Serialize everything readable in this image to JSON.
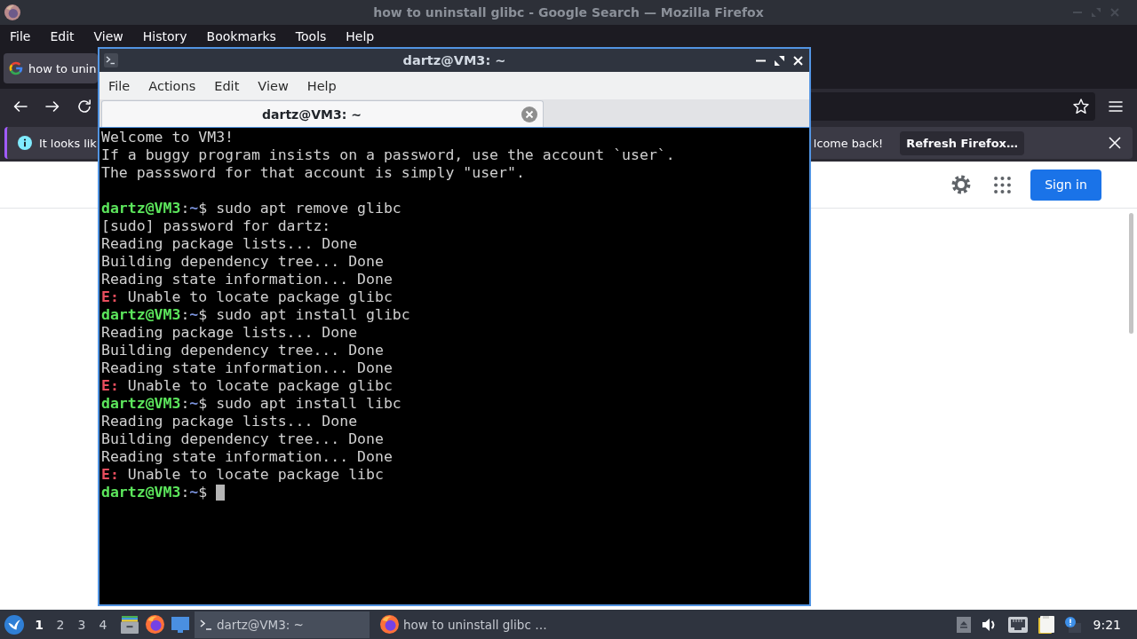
{
  "browser": {
    "title": "how to uninstall glibc - Google Search — Mozilla Firefox",
    "menu": [
      "File",
      "Edit",
      "View",
      "History",
      "Bookmarks",
      "Tools",
      "Help"
    ],
    "tabs": [
      {
        "label": "how to unin",
        "selected": true
      }
    ],
    "notification": {
      "text_start": "It looks lik",
      "text_end": "lcome back!",
      "button": "Refresh Firefox…"
    },
    "page": {
      "sign_in": "Sign in"
    }
  },
  "terminal": {
    "title": "dartz@VM3: ~",
    "menu": [
      "File",
      "Actions",
      "Edit",
      "View",
      "Help"
    ],
    "tabs": [
      {
        "label": "dartz@VM3: ~",
        "selected": true
      }
    ],
    "blocks": [
      {
        "lines": [
          {
            "segments": [
              {
                "kind": "plain",
                "text": "Welcome to VM3!"
              }
            ]
          },
          {
            "segments": [
              {
                "kind": "plain",
                "text": "If a buggy program insists on a password, use the account `user`."
              }
            ]
          },
          {
            "segments": [
              {
                "kind": "plain",
                "text": "The passsword for that account is simply \"user\"."
              }
            ]
          }
        ]
      },
      {
        "lines": [
          {
            "segments": [
              {
                "kind": "user",
                "text": "dartz@VM3"
              },
              {
                "kind": "plain",
                "text": ":"
              },
              {
                "kind": "path",
                "text": "~"
              },
              {
                "kind": "plain",
                "text": "$ sudo apt remove glibc"
              }
            ]
          },
          {
            "segments": [
              {
                "kind": "plain",
                "text": "[sudo] password for dartz:"
              }
            ]
          },
          {
            "segments": [
              {
                "kind": "plain",
                "text": "Reading package lists... Done"
              }
            ]
          },
          {
            "segments": [
              {
                "kind": "plain",
                "text": "Building dependency tree... Done"
              }
            ]
          },
          {
            "segments": [
              {
                "kind": "plain",
                "text": "Reading state information... Done"
              }
            ]
          },
          {
            "segments": [
              {
                "kind": "error",
                "text": "E:"
              },
              {
                "kind": "plain",
                "text": " Unable to locate package glibc"
              }
            ]
          },
          {
            "segments": [
              {
                "kind": "user",
                "text": "dartz@VM3"
              },
              {
                "kind": "plain",
                "text": ":"
              },
              {
                "kind": "path",
                "text": "~"
              },
              {
                "kind": "plain",
                "text": "$ sudo apt install glibc"
              }
            ]
          },
          {
            "segments": [
              {
                "kind": "plain",
                "text": "Reading package lists... Done"
              }
            ]
          },
          {
            "segments": [
              {
                "kind": "plain",
                "text": "Building dependency tree... Done"
              }
            ]
          },
          {
            "segments": [
              {
                "kind": "plain",
                "text": "Reading state information... Done"
              }
            ]
          },
          {
            "segments": [
              {
                "kind": "error",
                "text": "E:"
              },
              {
                "kind": "plain",
                "text": " Unable to locate package glibc"
              }
            ]
          },
          {
            "segments": [
              {
                "kind": "user",
                "text": "dartz@VM3"
              },
              {
                "kind": "plain",
                "text": ":"
              },
              {
                "kind": "path",
                "text": "~"
              },
              {
                "kind": "plain",
                "text": "$ sudo apt install libc"
              }
            ]
          },
          {
            "segments": [
              {
                "kind": "plain",
                "text": "Reading package lists... Done"
              }
            ]
          },
          {
            "segments": [
              {
                "kind": "plain",
                "text": "Building dependency tree... Done"
              }
            ]
          },
          {
            "segments": [
              {
                "kind": "plain",
                "text": "Reading state information... Done"
              }
            ]
          },
          {
            "segments": [
              {
                "kind": "error",
                "text": "E:"
              },
              {
                "kind": "plain",
                "text": " Unable to locate package libc"
              }
            ]
          },
          {
            "segments": [
              {
                "kind": "user",
                "text": "dartz@VM3"
              },
              {
                "kind": "plain",
                "text": ":"
              },
              {
                "kind": "path",
                "text": "~"
              },
              {
                "kind": "plain",
                "text": "$"
              }
            ]
          }
        ]
      }
    ],
    "cursor": true
  },
  "taskbar": {
    "workspaces": [
      {
        "label": "1",
        "selected": true
      },
      {
        "label": "2",
        "selected": false
      },
      {
        "label": "3",
        "selected": false
      },
      {
        "label": "4",
        "selected": false
      }
    ],
    "tasks": [
      {
        "kind": "terminal",
        "label": "dartz@VM3: ~",
        "selected": true
      },
      {
        "kind": "browser",
        "label": "how to uninstall glibc …",
        "selected": false
      }
    ],
    "clock": "9:21"
  }
}
